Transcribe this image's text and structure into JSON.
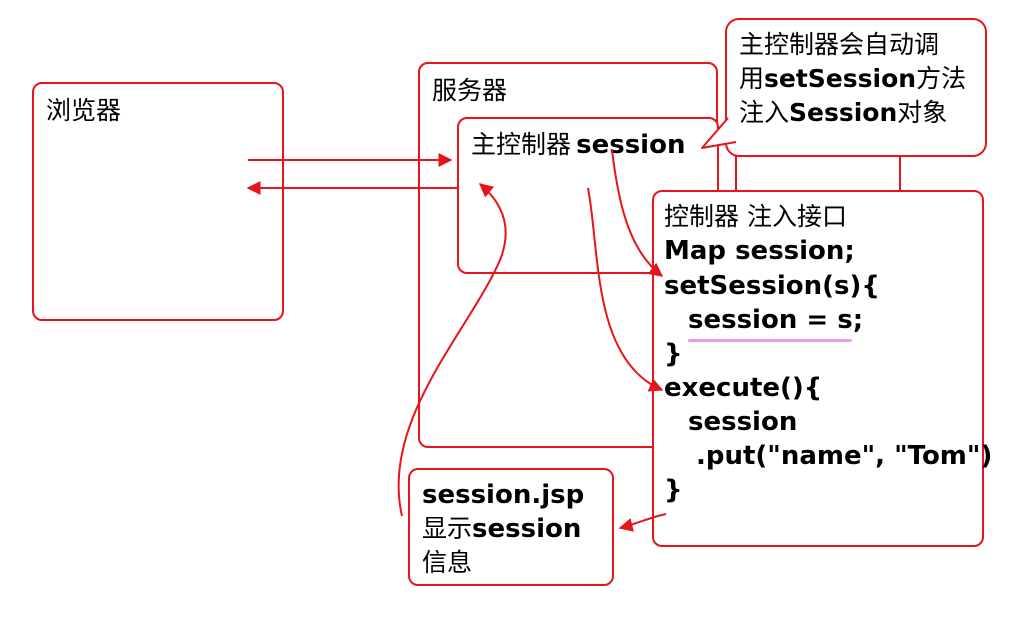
{
  "browser": {
    "label": "浏览器"
  },
  "server": {
    "label": "服务器"
  },
  "main_controller": {
    "label_cn": "主控制器",
    "label_code": "session"
  },
  "callout": {
    "line1": "主控制器会自动调",
    "line2_cn": "用",
    "line2_code": "setSession",
    "line2_tail": "方法",
    "line3_cn": "注入",
    "line3_code": "Session",
    "line3_tail": "对象"
  },
  "controller": {
    "title": "控制器 注入接口",
    "code_lines": [
      "Map session;",
      "setSession(s){",
      "session = s;",
      "}",
      "execute(){",
      "session",
      ".put(\"name\", \"Tom\")",
      "}"
    ]
  },
  "jsp": {
    "file": "session.jsp",
    "line2_cn": "显示",
    "line2_code": "session",
    "line3": "信息"
  },
  "colors": {
    "border": "#e8141c",
    "highlight": "#e99be8"
  }
}
